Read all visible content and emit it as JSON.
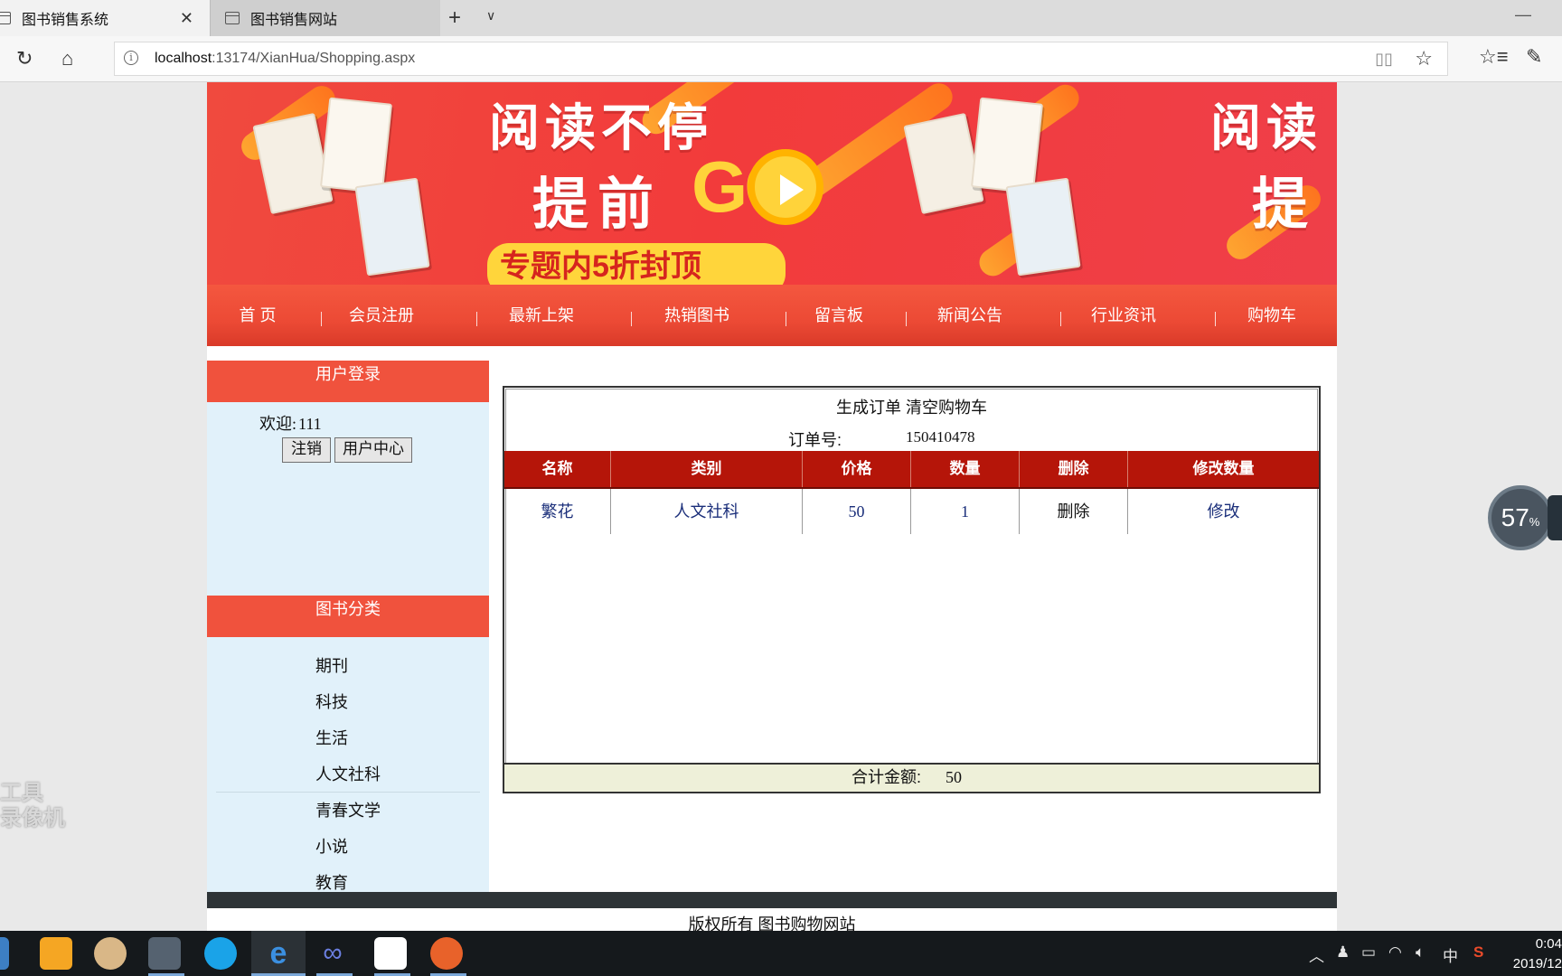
{
  "browser": {
    "tabs": [
      {
        "title": "图书销售系统",
        "active": true
      },
      {
        "title": "图书销售网站",
        "active": false
      }
    ],
    "url_host": "localhost",
    "url_path": ":13174/XianHua/Shopping.aspx",
    "icons": [
      "refresh-icon",
      "home-icon",
      "info-icon",
      "reading-view-icon",
      "favorite-star-icon",
      "favorites-hub-icon",
      "notes-pen-icon"
    ]
  },
  "banner": {
    "line1": "阅读不停",
    "line2_prefix": "提前",
    "line2_brand": "GO",
    "repeat_line1": "阅读",
    "repeat_line2": "提",
    "promo": "专题内5折封顶",
    "colors": {
      "background": "#f23b3b",
      "accent": "#ffd33a"
    }
  },
  "nav": {
    "items": [
      "首 页",
      "会员注册",
      "最新上架",
      "热销图书",
      "留言板",
      "新闻公告",
      "行业资讯",
      "购物车"
    ]
  },
  "sidebar": {
    "login_title": "用户登录",
    "welcome_label": "欢迎:",
    "welcome_user": "111",
    "logout_button": "注销",
    "user_center_button": "用户中心",
    "category_title": "图书分类",
    "categories": [
      "期刊",
      "科技",
      "生活",
      "人文社科",
      "青春文学",
      "小说",
      "教育"
    ]
  },
  "cart": {
    "generate_order": "生成订单",
    "clear_cart": "清空购物车",
    "order_no_label": "订单号:",
    "order_no": "150410478",
    "columns": [
      "名称",
      "类别",
      "价格",
      "数量",
      "删除",
      "修改数量"
    ],
    "rows": [
      {
        "name": "繁花",
        "category": "人文社科",
        "price": "50",
        "quantity": "1",
        "delete": "删除",
        "modify": "修改"
      }
    ],
    "total_label": "合计金额:",
    "total_value": "50"
  },
  "footer": {
    "copyright": "版权所有 图书购物网站"
  },
  "overlay": {
    "speed_value": "57",
    "speed_unit": "%",
    "watermark": "工具\n录像机"
  },
  "taskbar": {
    "tray_ime": "中",
    "clock_time": "0:04",
    "clock_date": "2019/12"
  }
}
